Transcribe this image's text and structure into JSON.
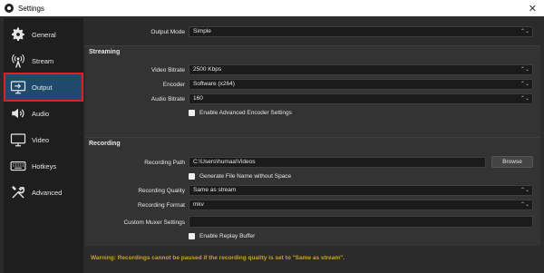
{
  "window": {
    "title": "Settings",
    "close_glyph": "✕"
  },
  "sidebar": {
    "items": [
      {
        "label": "General",
        "icon": "gear-icon"
      },
      {
        "label": "Stream",
        "icon": "antenna-icon"
      },
      {
        "label": "Output",
        "icon": "monitor-arrow-icon",
        "active": true
      },
      {
        "label": "Audio",
        "icon": "speaker-icon"
      },
      {
        "label": "Video",
        "icon": "monitor-icon"
      },
      {
        "label": "Hotkeys",
        "icon": "keyboard-icon"
      },
      {
        "label": "Advanced",
        "icon": "tools-icon"
      }
    ]
  },
  "output_mode": {
    "label": "Output Mode",
    "value": "Simple"
  },
  "streaming": {
    "title": "Streaming",
    "video_bitrate": {
      "label": "Video Bitrate",
      "value": "2500 Kbps"
    },
    "encoder": {
      "label": "Encoder",
      "value": "Software (x264)"
    },
    "audio_bitrate": {
      "label": "Audio Bitrate",
      "value": "160"
    },
    "advanced_encoder": {
      "label": "Enable Advanced Encoder Settings",
      "checked": false
    }
  },
  "recording": {
    "title": "Recording",
    "path": {
      "label": "Recording Path",
      "value": "C:\\Users\\humaa\\Videos"
    },
    "browse_label": "Browse",
    "generate_name": {
      "label": "Generate File Name without Space",
      "checked": false
    },
    "quality": {
      "label": "Recording Quality",
      "value": "Same as stream"
    },
    "format": {
      "label": "Recording Format",
      "value": "mkv"
    },
    "muxer": {
      "label": "Custom Muxer Settings",
      "value": ""
    },
    "replay_buffer": {
      "label": "Enable Replay Buffer",
      "checked": false
    }
  },
  "warning": "Warning: Recordings cannot be paused if the recording quality is set to \"Same as stream\".",
  "colors": {
    "accent": "#1f4a6d",
    "highlight_border": "#e02020",
    "warning": "#c9a227"
  }
}
